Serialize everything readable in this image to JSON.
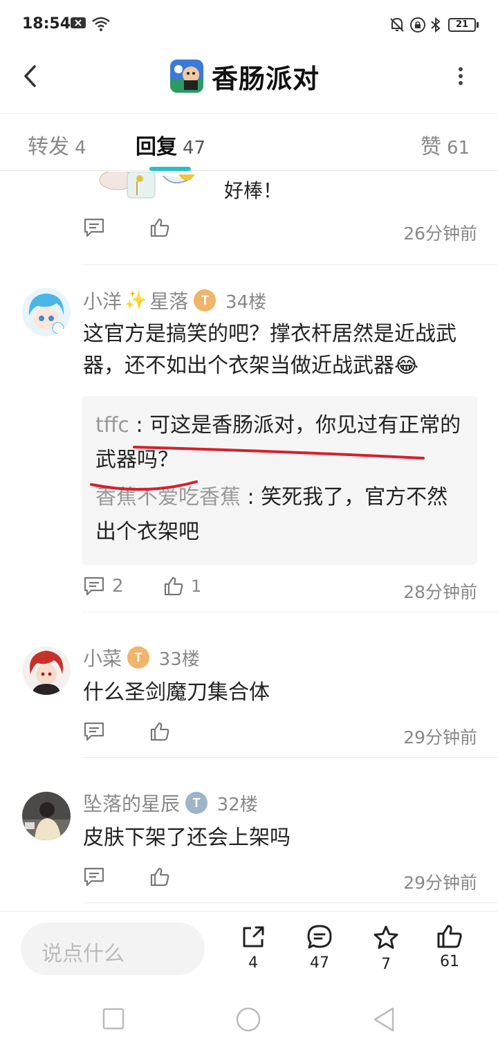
{
  "status_bar": {
    "time": "18:54",
    "battery": "21"
  },
  "nav": {
    "title": "香肠派对"
  },
  "tabs": [
    {
      "label": "转发",
      "count": "4"
    },
    {
      "label": "回复",
      "count": "47"
    },
    {
      "label": "赞",
      "count": "61"
    }
  ],
  "partial_comment": {
    "text": "好棒！",
    "time": "26分钟前"
  },
  "comments": [
    {
      "username_a": "小洋",
      "username_b": "星落",
      "medal": "5",
      "floor": "34楼",
      "text": "这官方是搞笑的吧？撑衣杆居然是近战武器，还不如出个衣架当做近战武器😂",
      "replies": [
        {
          "name": "tffc",
          "sep": " : ",
          "text": "可这是香肠派对，你见过有正常的武器吗？"
        },
        {
          "name": "香蕉不爱吃香蕉",
          "sep": " : ",
          "text": "笑死我了，官方不然出个衣架吧"
        }
      ],
      "reply_count": "2",
      "like_count": "1",
      "time": "28分钟前"
    },
    {
      "username": "小菜",
      "medal": "4",
      "floor": "33楼",
      "text": "什么圣剑魔刀集合体",
      "time": "29分钟前"
    },
    {
      "username": "坠落的星辰",
      "medal": "1",
      "floor": "32楼",
      "text": "皮肤下架了还会上架吗",
      "time": "29分钟前"
    }
  ],
  "bottom_bar": {
    "placeholder": "说点什么",
    "share_count": "4",
    "comment_count": "47",
    "favorite_count": "7",
    "like_count": "61"
  },
  "colors": {
    "accent": "#27c0c8",
    "underline": "#d6202a",
    "medal_gold": "#f0b46a",
    "medal_silver": "#9fb4c8"
  }
}
